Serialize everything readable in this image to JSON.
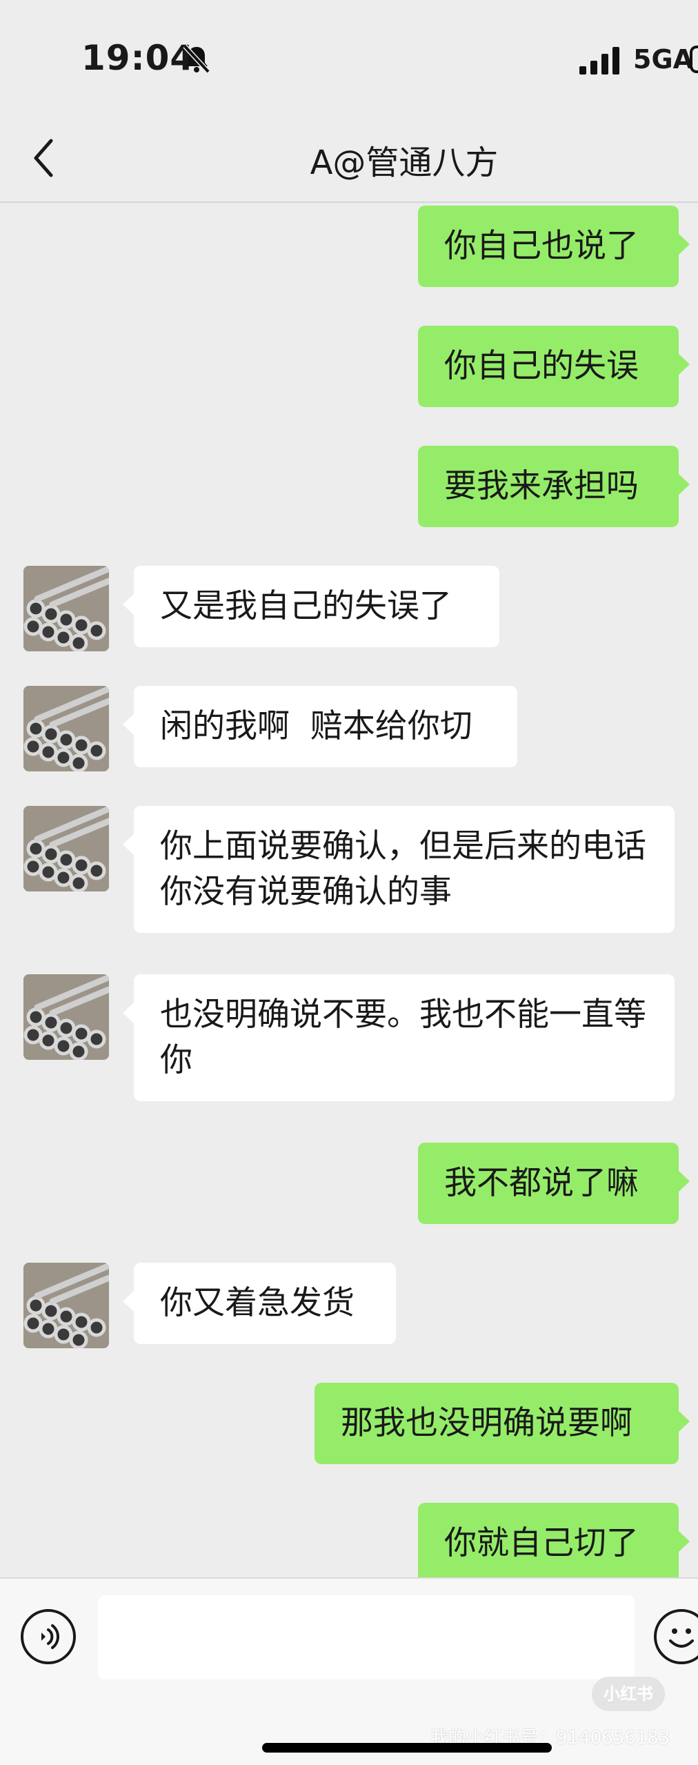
{
  "status_bar": {
    "time": "19:04",
    "network": "5GA",
    "icons": [
      "bell-muted-icon",
      "signal-bars-icon",
      "battery-icon"
    ]
  },
  "nav": {
    "title": "A@管通八方",
    "back_icon": "chevron-left-icon"
  },
  "messages": [
    {
      "from": "me",
      "text": "你自己也说了"
    },
    {
      "from": "me",
      "text": "你自己的失误"
    },
    {
      "from": "me",
      "text": "要我来承担吗"
    },
    {
      "from": "other",
      "text": "又是我自己的失误了"
    },
    {
      "from": "other",
      "text": "闲的我啊  赔本给你切"
    },
    {
      "from": "other",
      "text": "你上面说要确认，但是后来的电话你没有说要确认的事"
    },
    {
      "from": "other",
      "text": "也没明确说不要。我也不能一直等你"
    },
    {
      "from": "me",
      "text": "我不都说了嘛"
    },
    {
      "from": "other",
      "text": "你又着急发货"
    },
    {
      "from": "me",
      "text": "那我也没明确说要啊"
    },
    {
      "from": "me",
      "text": "你就自己切了"
    }
  ],
  "input_bar": {
    "voice_icon": "voice-icon",
    "emoji_icon": "emoji-icon",
    "input_value": ""
  },
  "watermark": {
    "badge": "小红书",
    "text": "我的小红书号：9140656183"
  },
  "colors": {
    "background": "#ededed",
    "outgoing_bubble": "#95ec69",
    "incoming_bubble": "#ffffff"
  }
}
